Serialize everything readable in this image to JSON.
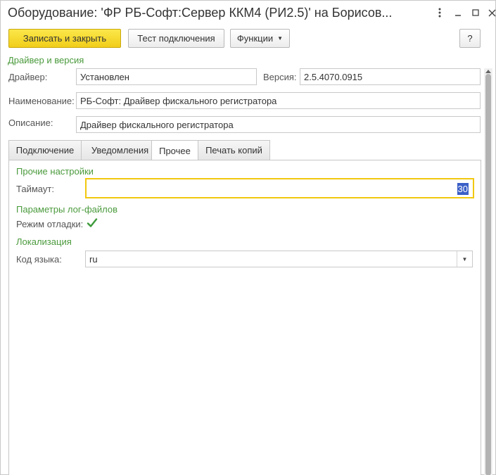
{
  "window": {
    "title": "Оборудование: 'ФР РБ-Софт:Сервер ККМ4 (РИ2.5)' на Борисов...",
    "controls": [
      "more-icon",
      "minimize-icon",
      "maximize-icon",
      "close-icon"
    ]
  },
  "toolbar": {
    "save_close_label": "Записать и закрыть",
    "test_connection_label": "Тест подключения",
    "functions_label": "Функции",
    "help_label": "?"
  },
  "driver_section": {
    "title": "Драйвер и версия",
    "driver_label": "Драйвер:",
    "driver_value": "Установлен",
    "version_label": "Версия:",
    "version_value": "2.5.4070.0915"
  },
  "name_label": "Наименование:",
  "name_value": "РБ-Софт: Драйвер фискального регистратора",
  "description_label": "Описание:",
  "description_value": "Драйвер фискального регистратора",
  "tabs": [
    {
      "label": "Подключение",
      "active": false
    },
    {
      "label": "Уведомления",
      "active": false
    },
    {
      "label": "Прочее",
      "active": true
    },
    {
      "label": "Печать копий",
      "active": false
    }
  ],
  "other_settings": {
    "title": "Прочие настройки",
    "timeout_label": "Таймаут:",
    "timeout_value": "30"
  },
  "log_params": {
    "title": "Параметры лог-файлов",
    "debug_label": "Режим отладки:",
    "debug_checked": true
  },
  "localization": {
    "title": "Локализация",
    "lang_label": "Код языка:",
    "lang_value": "ru"
  },
  "colors": {
    "accent_green": "#4a9a3c",
    "primary_button": "#f1cd1a",
    "focus_border": "#f2c80f",
    "selection": "#3b5fc7"
  }
}
